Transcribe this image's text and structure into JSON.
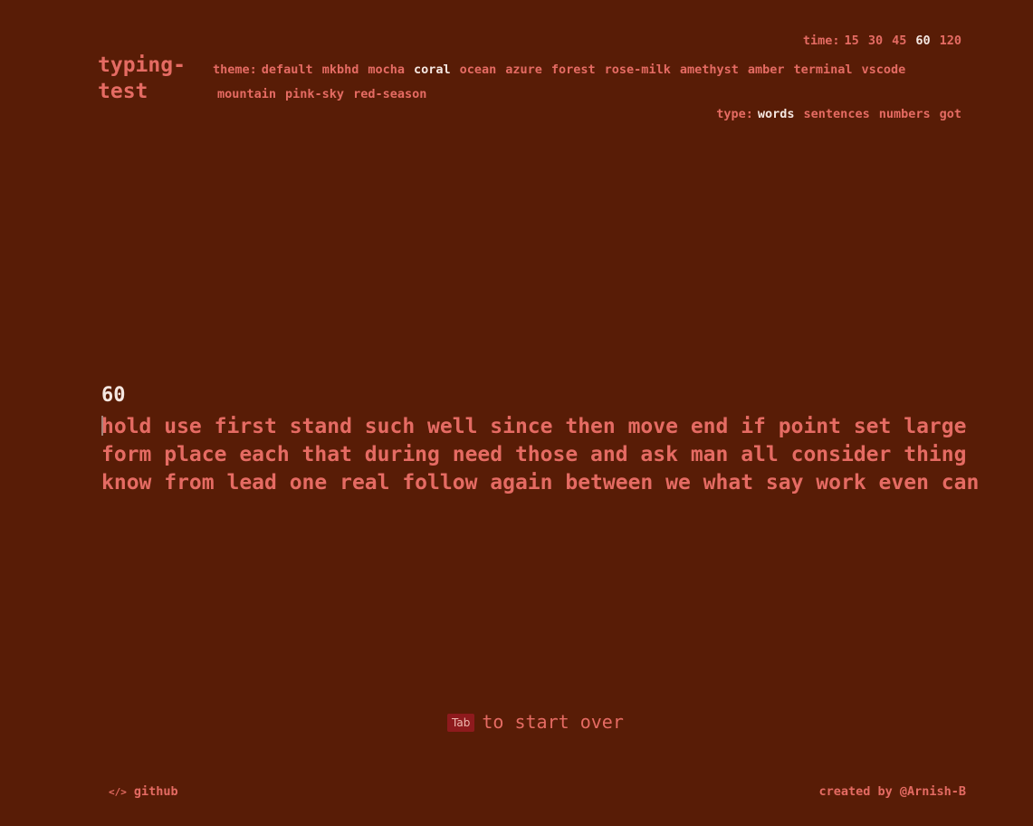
{
  "app": {
    "logo": "typing-\ntest"
  },
  "time": {
    "label": "time:",
    "options": [
      "15",
      "30",
      "45",
      "60",
      "120"
    ],
    "selected": "60"
  },
  "theme": {
    "label": "theme:",
    "options_line1": [
      "default",
      "mkbhd",
      "mocha",
      "coral",
      "ocean",
      "azure",
      "forest",
      "rose-milk",
      "amethyst",
      "amber",
      "terminal",
      "vscode"
    ],
    "options_line2": [
      "mountain",
      "pink-sky",
      "red-season"
    ],
    "selected": "coral"
  },
  "type": {
    "label": "type:",
    "options": [
      "words",
      "sentences",
      "numbers",
      "got"
    ],
    "selected": "words"
  },
  "test": {
    "timer": "60",
    "lines": [
      "hold use first stand such well since then move end if point set large",
      "form place each that during need those and ask man all consider thing",
      "know from lead one real follow again between we what say work even can"
    ]
  },
  "restart": {
    "key": "Tab",
    "text": "to start over"
  },
  "footer": {
    "icon": "code-icon",
    "icon_glyph": "</>",
    "github_label": "github",
    "credit": "created by @Arnish-B"
  },
  "colors": {
    "background": "#581c06",
    "text": "#e56b63",
    "active": "#f5e7e1",
    "key_bg": "#8e1a1d"
  }
}
